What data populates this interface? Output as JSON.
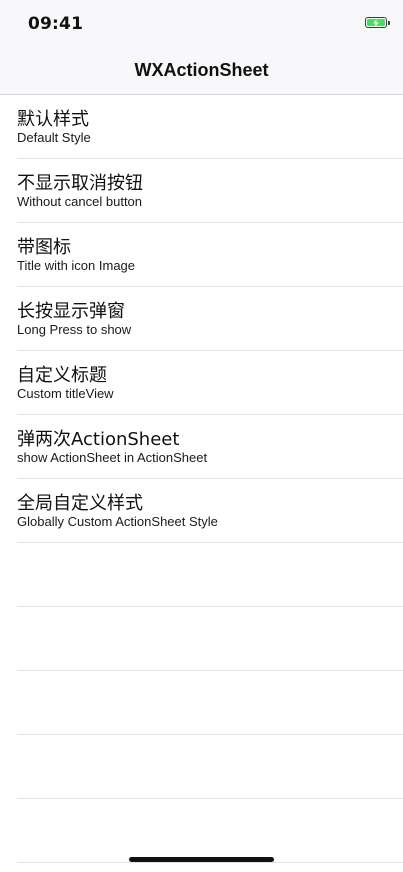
{
  "status_bar": {
    "time": "09:41",
    "battery_icon": "battery-charging-icon",
    "battery_color": "#4cd964"
  },
  "nav": {
    "title": "WXActionSheet"
  },
  "items": [
    {
      "title": "默认样式",
      "subtitle": "Default Style"
    },
    {
      "title": "不显示取消按钮",
      "subtitle": "Without cancel button"
    },
    {
      "title": "带图标",
      "subtitle": "Title with icon Image"
    },
    {
      "title": "长按显示弹窗",
      "subtitle": "Long Press to show"
    },
    {
      "title": "自定义标题",
      "subtitle": "Custom titleView"
    },
    {
      "title": "弹两次ActionSheet",
      "subtitle": "show ActionSheet in ActionSheet"
    },
    {
      "title": "全局自定义样式",
      "subtitle": "Globally Custom ActionSheet Style"
    }
  ]
}
